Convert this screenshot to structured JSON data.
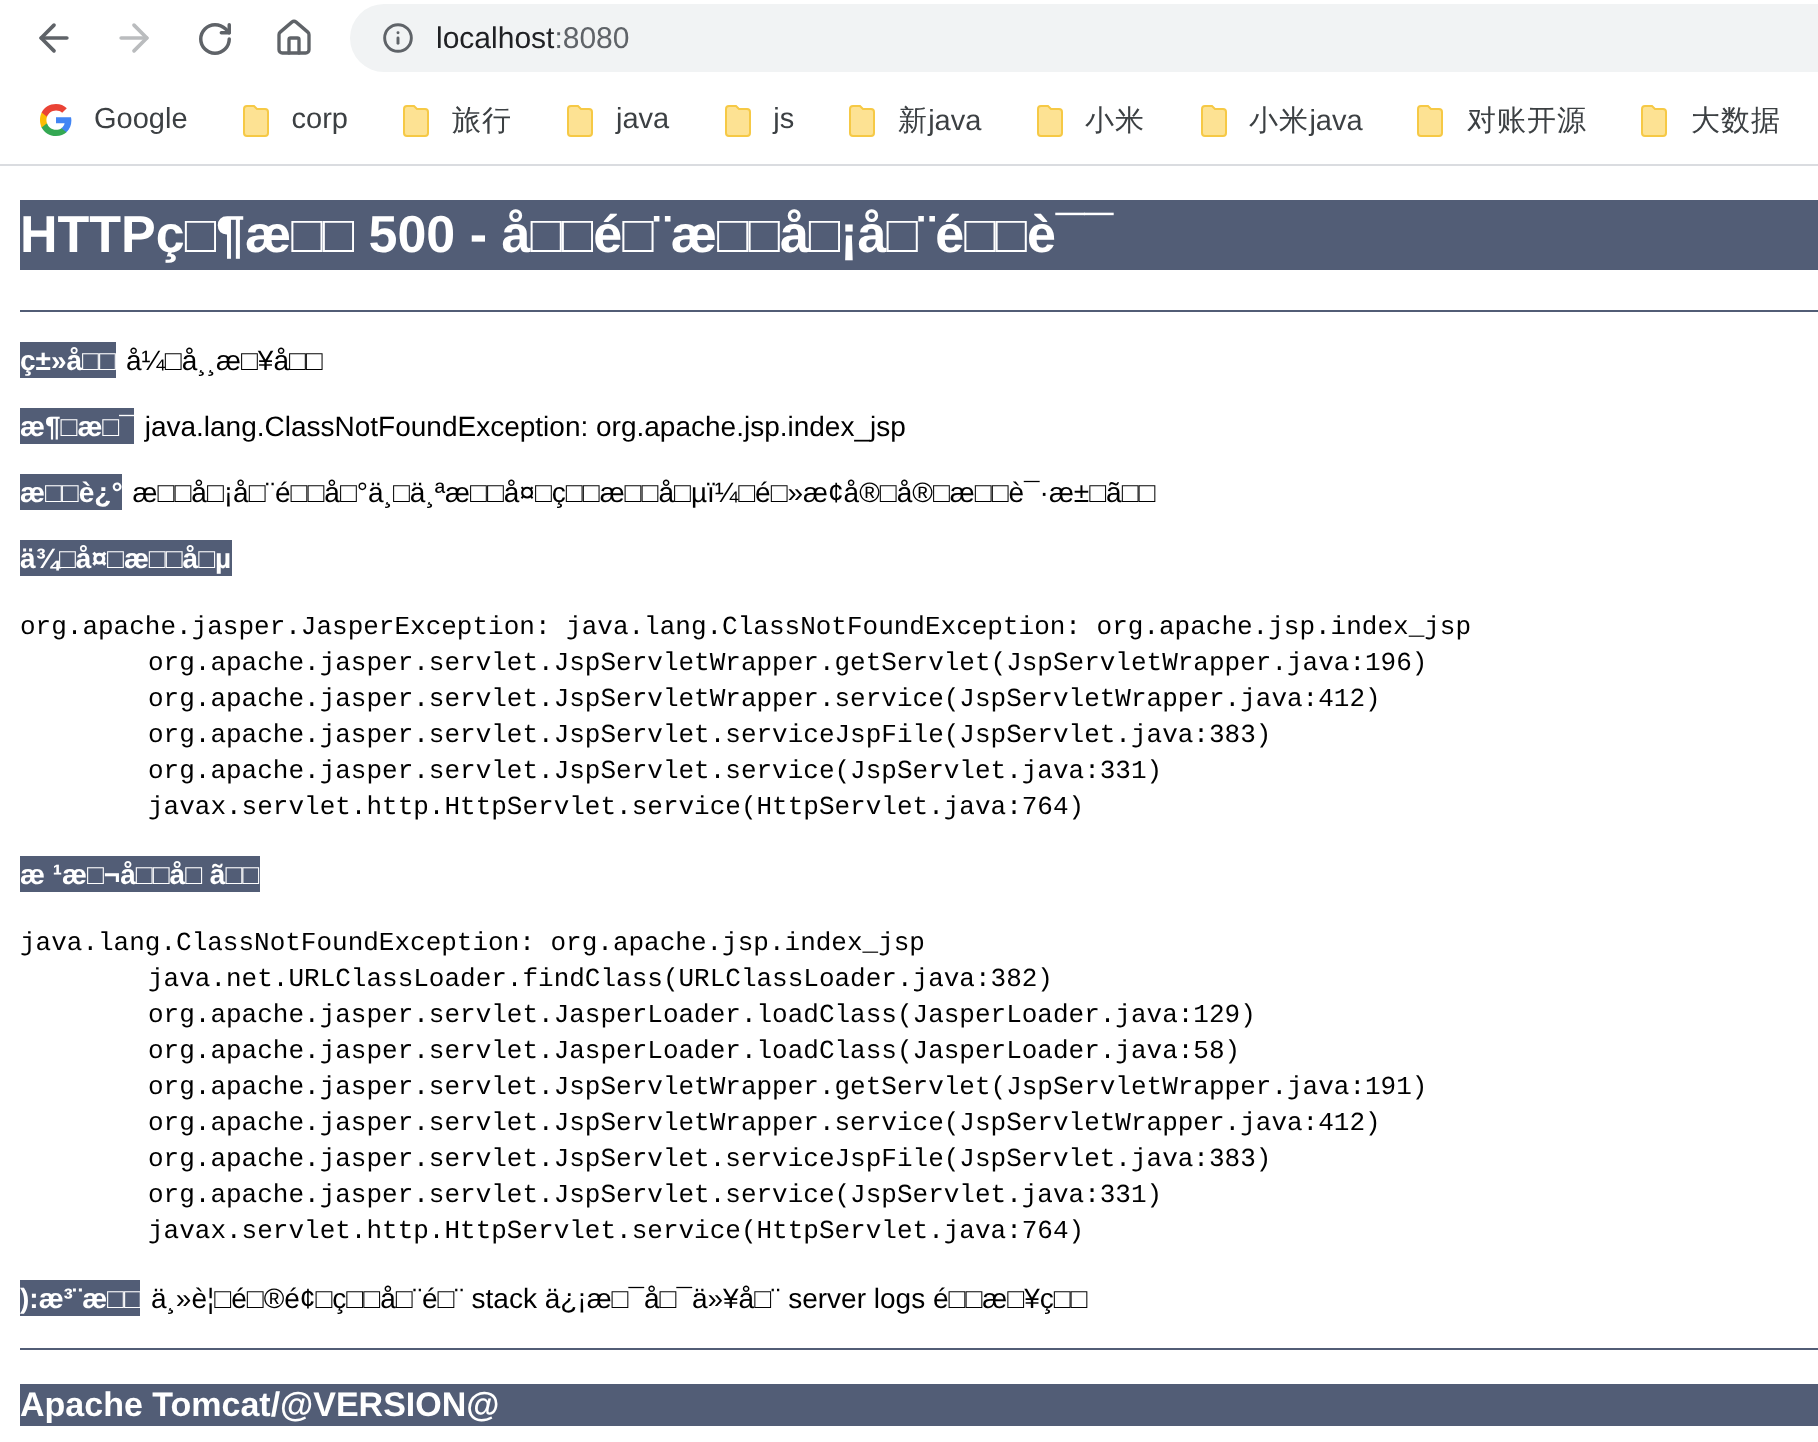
{
  "nav_buttons": [
    {
      "kind": "back",
      "disabled": false
    },
    {
      "kind": "forward",
      "disabled": true
    },
    {
      "kind": "reload",
      "disabled": false
    },
    {
      "kind": "home",
      "disabled": false
    }
  ],
  "address": {
    "host": "localhost",
    "port": ":8080"
  },
  "bookmarks": [
    {
      "kind": "google",
      "label": "Google"
    },
    {
      "kind": "folder",
      "label": "corp"
    },
    {
      "kind": "folder",
      "label": "旅行"
    },
    {
      "kind": "folder",
      "label": "java"
    },
    {
      "kind": "folder",
      "label": "js"
    },
    {
      "kind": "folder",
      "label": "新java"
    },
    {
      "kind": "folder",
      "label": "小米"
    },
    {
      "kind": "folder",
      "label": "小米java"
    },
    {
      "kind": "folder",
      "label": "对账开源"
    },
    {
      "kind": "folder",
      "label": "大数据"
    }
  ],
  "heading": "HTTPç□¶æ□□ 500 - å□□é□¨æ□□å□¡å□¨é□□è¯¯",
  "fields": [
    {
      "label": "ç±»å□□",
      "value": "å¼□å¸¸æ□¥å□□"
    },
    {
      "label": "æ¶□æ□¯",
      "value": "java.lang.ClassNotFoundException: org.apache.jsp.index_jsp"
    },
    {
      "label": "æ□□è¿°",
      "value": "æ□□å□¡å□¨é□□å□°ä¸□ä¸ªæ□□å¤□ç□□æ□□å□µï¼□é□»æ¢å®□å®□æ□□è¯·æ±□ã□□"
    }
  ],
  "sections": [
    {
      "label": "ä¾□å¤□æ□□å□µ",
      "trace": {
        "head": "org.apache.jasper.JasperException: java.lang.ClassNotFoundException: org.apache.jsp.index_jsp",
        "frames": [
          "org.apache.jasper.servlet.JspServletWrapper.getServlet(JspServletWrapper.java:196)",
          "org.apache.jasper.servlet.JspServletWrapper.service(JspServletWrapper.java:412)",
          "org.apache.jasper.servlet.JspServlet.serviceJspFile(JspServlet.java:383)",
          "org.apache.jasper.servlet.JspServlet.service(JspServlet.java:331)",
          "javax.servlet.http.HttpServlet.service(HttpServlet.java:764)"
        ]
      }
    },
    {
      "label": "æ ¹æ□¬å□□å□ ã□□",
      "trace": {
        "head": "java.lang.ClassNotFoundException: org.apache.jsp.index_jsp",
        "frames": [
          "java.net.URLClassLoader.findClass(URLClassLoader.java:382)",
          "org.apache.jasper.servlet.JasperLoader.loadClass(JasperLoader.java:129)",
          "org.apache.jasper.servlet.JasperLoader.loadClass(JasperLoader.java:58)",
          "org.apache.jasper.servlet.JspServletWrapper.getServlet(JspServletWrapper.java:191)",
          "org.apache.jasper.servlet.JspServletWrapper.service(JspServletWrapper.java:412)",
          "org.apache.jasper.servlet.JspServlet.serviceJspFile(JspServlet.java:383)",
          "org.apache.jasper.servlet.JspServlet.service(JspServlet.java:331)",
          "javax.servlet.http.HttpServlet.service(HttpServlet.java:764)"
        ]
      }
    }
  ],
  "note": {
    "label": "):æ³¨æ□□",
    "value": "ä¸»è¦□é□®é¢□ç□□å□¨é□¨ stack ä¿¡æ□¯å□¯ä»¥å□¨ server logs é□□æ□¥ç□□"
  },
  "footer": "Apache Tomcat/@VERSION@"
}
